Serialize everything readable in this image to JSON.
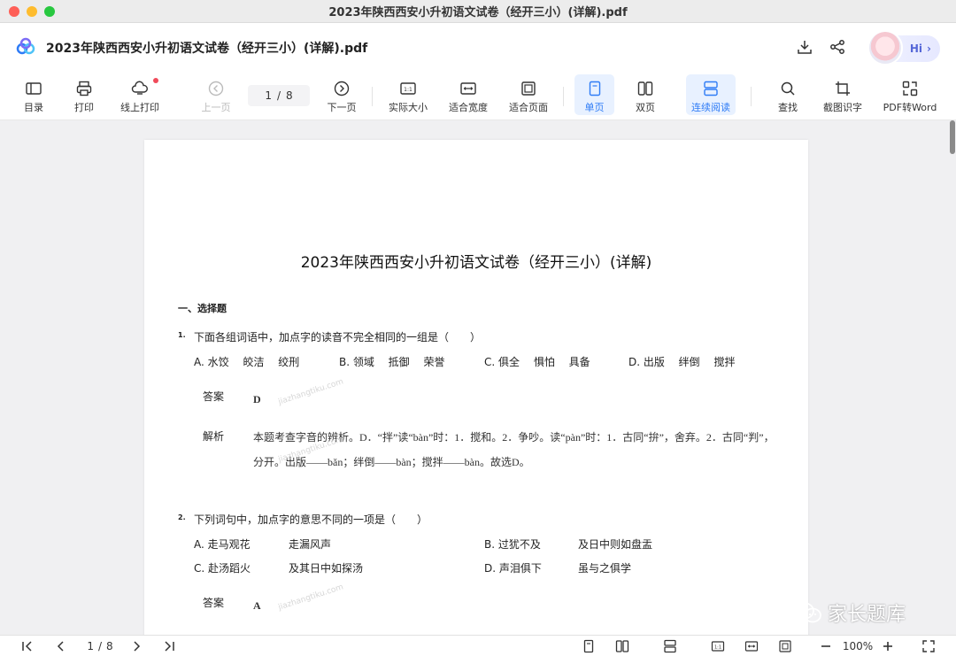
{
  "window": {
    "title": "2023年陕西西安小升初语文试卷（经开三小）(详解).pdf"
  },
  "header": {
    "doc_title": "2023年陕西西安小升初语文试卷（经开三小）(详解).pdf",
    "hi_label": "Hi",
    "hi_chevron": "›"
  },
  "toolbar": {
    "toc": "目录",
    "print": "打印",
    "online_print": "线上打印",
    "prev_page": "上一页",
    "current_page": "1",
    "page_sep": "/",
    "total_pages": "8",
    "next_page": "下一页",
    "actual_size": "实际大小",
    "fit_width": "适合宽度",
    "fit_page": "适合页面",
    "single_page": "单页",
    "double_page": "双页",
    "continuous": "连续阅读",
    "search": "查找",
    "ocr": "截图识字",
    "pdf_to_word": "PDF转Word",
    "actual_size_icon_text": "1:1"
  },
  "document": {
    "title": "2023年陕西西安小升初语文试卷（经开三小）(详解)",
    "section1": "一、选择题",
    "q1": {
      "num": "1.",
      "text": "下面各组词语中，加点字的读音不完全相同的一组是（　　）",
      "options": [
        "A. 水饺　 皎洁　 绞刑",
        "B. 领域　 抵御　 荣誉",
        "C. 俱全　 惧怕　 具备",
        "D. 出版　 绊倒　 搅拌"
      ],
      "answer_label": "答案",
      "answer": "D",
      "analysis_label": "解析",
      "analysis_line1": "本题考查字音的辨析。D．“拌”读“bàn”时：1．搅和。2．争吵。读“pàn”时：1．古同“拚”，舍弃。2．古同“判”，",
      "analysis_line2": "分开。出版——bǎn；绊倒——bàn；搅拌——bàn。故选D。"
    },
    "q2": {
      "num": "2.",
      "text": "下列词句中，加点字的意思不同的一项是（　　）",
      "options": [
        "A. 走马观花",
        "走漏风声",
        "B. 过犹不及",
        "及日中则如盘盂",
        "C. 赴汤蹈火",
        "及其日中如探汤",
        "D. 声泪俱下",
        "虽与之俱学"
      ],
      "answer_label": "答案",
      "answer": "A"
    },
    "watermark": "jiazhangtiku.com"
  },
  "bottombar": {
    "current_page": "1",
    "page_sep": "/",
    "total_pages": "8",
    "zoom": "100%",
    "actual_size_icon_text": "1:1"
  },
  "brand_watermark": {
    "text": "家长题库"
  },
  "colors": {
    "accent": "#2f7cf6",
    "active_bg": "#e8f1ff",
    "notify_dot": "#f04a5a"
  }
}
